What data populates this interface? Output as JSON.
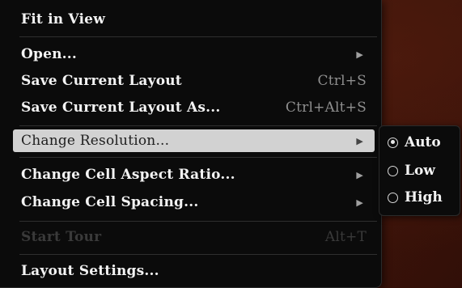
{
  "menu": {
    "items": [
      {
        "label": "Fit in View",
        "shortcut": "",
        "has_submenu": false,
        "disabled": false
      },
      {
        "label": "Open...",
        "shortcut": "",
        "has_submenu": true,
        "disabled": false
      },
      {
        "label": "Save Current Layout",
        "shortcut": "Ctrl+S",
        "has_submenu": false,
        "disabled": false
      },
      {
        "label": "Save Current Layout As...",
        "shortcut": "Ctrl+Alt+S",
        "has_submenu": false,
        "disabled": false
      },
      {
        "label": "Change Resolution...",
        "shortcut": "",
        "has_submenu": true,
        "disabled": false,
        "highlighted": true
      },
      {
        "label": "Change Cell Aspect Ratio...",
        "shortcut": "",
        "has_submenu": true,
        "disabled": false
      },
      {
        "label": "Change Cell Spacing...",
        "shortcut": "",
        "has_submenu": true,
        "disabled": false
      },
      {
        "label": "Start Tour",
        "shortcut": "Alt+T",
        "has_submenu": false,
        "disabled": true
      },
      {
        "label": "Layout Settings...",
        "shortcut": "",
        "has_submenu": false,
        "disabled": false
      }
    ],
    "arrow_glyph": "▶"
  },
  "resolution_submenu": {
    "options": [
      {
        "label": "Auto",
        "checked": true
      },
      {
        "label": "Low",
        "checked": false
      },
      {
        "label": "High",
        "checked": false
      }
    ]
  },
  "colors": {
    "menu_bg": "#0b0b0b",
    "highlight_bg": "#d2d2d2",
    "text": "#f3f3f3",
    "disabled_text": "#3a3a3a",
    "backdrop": "#3e160b"
  }
}
